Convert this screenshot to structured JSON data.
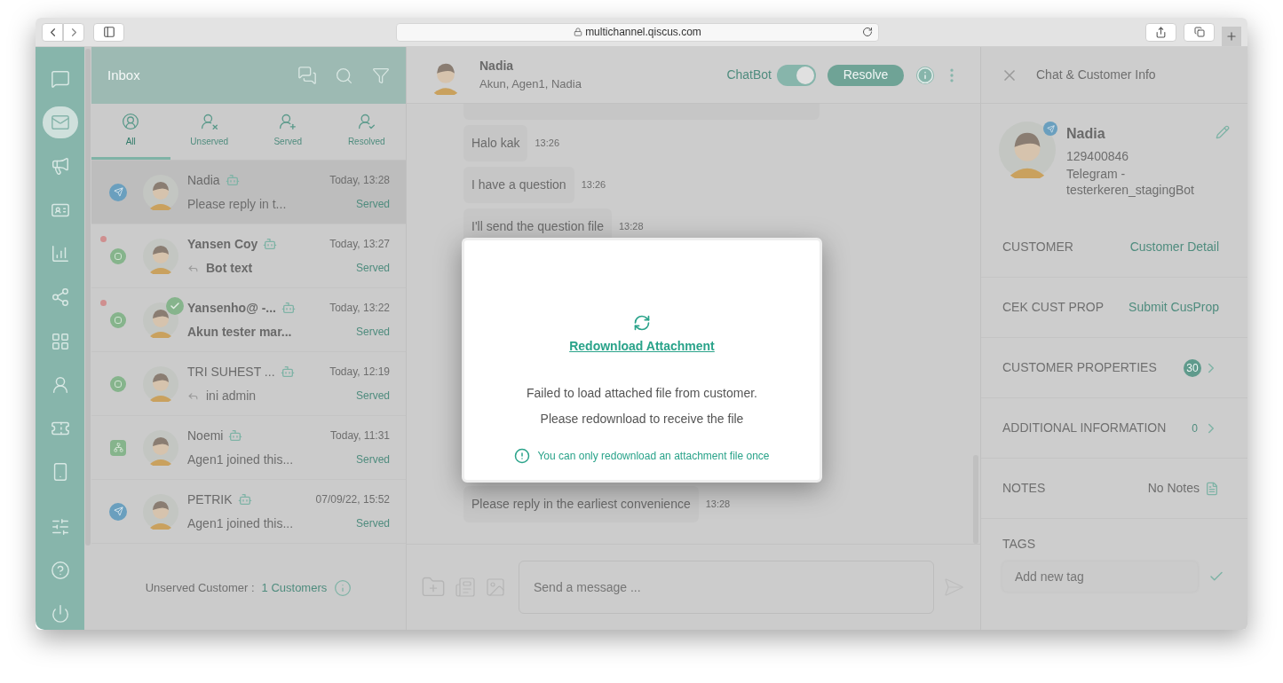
{
  "browser": {
    "url": "multichannel.qiscus.com"
  },
  "nav": [
    {
      "selected": false
    },
    {
      "selected": true
    },
    {
      "selected": false
    },
    {
      "selected": false
    },
    {
      "selected": false
    },
    {
      "selected": false
    },
    {
      "selected": false
    },
    {
      "selected": false
    },
    {
      "selected": false
    },
    {
      "selected": false
    },
    {
      "selected": false
    },
    {
      "selected": false
    },
    {
      "selected": false
    }
  ],
  "inbox": {
    "title": "Inbox",
    "tabs": [
      {
        "label": "All",
        "selected": true
      },
      {
        "label": "Unserved",
        "selected": false
      },
      {
        "label": "Served",
        "selected": false
      },
      {
        "label": "Resolved",
        "selected": false
      }
    ],
    "conversations": [
      {
        "name": "Nadia",
        "preview": "Please reply in t...",
        "time": "Today, 13:28",
        "status": "Served",
        "kind": "telegram",
        "unread": false,
        "replied": false,
        "checked": false,
        "selected": true
      },
      {
        "name": "Yansen Coy",
        "preview": "Bot text",
        "time": "Today, 13:27",
        "status": "Served",
        "kind": "qiscus",
        "unread": true,
        "replied": true,
        "checked": false,
        "selected": false
      },
      {
        "name": "Yansenho@ -...",
        "preview": "Akun tester mar...",
        "time": "Today, 13:22",
        "status": "Served",
        "kind": "qiscus",
        "unread": true,
        "replied": false,
        "checked": true,
        "selected": false
      },
      {
        "name": "TRI SUHEST ...",
        "preview": "ini admin",
        "time": "Today, 12:19",
        "status": "Served",
        "kind": "qiscus",
        "unread": false,
        "replied": true,
        "checked": false,
        "selected": false
      },
      {
        "name": "Noemi",
        "preview": "Agen1 joined this...",
        "time": "Today, 11:31",
        "status": "Served",
        "kind": "widget",
        "unread": false,
        "replied": false,
        "checked": false,
        "selected": false
      },
      {
        "name": "PETRIK",
        "preview": "Agen1 joined this...",
        "time": "07/09/22, 15:52",
        "status": "Served",
        "kind": "telegram",
        "unread": false,
        "replied": false,
        "checked": false,
        "selected": false
      }
    ],
    "footer": {
      "label": "Unserved Customer :",
      "value": "1 Customers"
    }
  },
  "chat": {
    "name": "Nadia",
    "participants": "Akun, Agen1, Nadia",
    "chatbot": {
      "label": "ChatBot",
      "on": true
    },
    "resolve": "Resolve",
    "messages": [
      {
        "text": "Halo kak",
        "time": "13:26"
      },
      {
        "text": "I have a question",
        "time": "13:26"
      },
      {
        "text": "I'll send the question file",
        "time": "13:28"
      },
      {
        "text": "Please reply in the earliest convenience",
        "time": "13:28"
      }
    ],
    "composer": {
      "placeholder": "Send a message ..."
    }
  },
  "modal": {
    "link": "Redownload Attachment",
    "message": [
      "Failed to load attached file from customer.",
      "Please redownload to receive the file"
    ],
    "note": "You can only redownload an attachment file once"
  },
  "info": {
    "title": "Chat & Customer Info",
    "profile": {
      "name": "Nadia",
      "id": "129400846",
      "channel": "Telegram - testerkeren_stagingBot"
    },
    "sections": [
      {
        "kind": "link",
        "label": "CUSTOMER",
        "value": "Customer Detail"
      },
      {
        "kind": "link",
        "label": "CEK CUST PROP",
        "value": "Submit CusProp"
      },
      {
        "kind": "badge",
        "label": "CUSTOMER PROPERTIES",
        "value": "30"
      },
      {
        "kind": "count",
        "label": "ADDITIONAL INFORMATION",
        "value": "0"
      },
      {
        "kind": "notes",
        "label": "NOTES",
        "value": "No Notes"
      },
      {
        "kind": "tags",
        "label": "TAGS",
        "placeholder": "Add new tag"
      }
    ]
  }
}
